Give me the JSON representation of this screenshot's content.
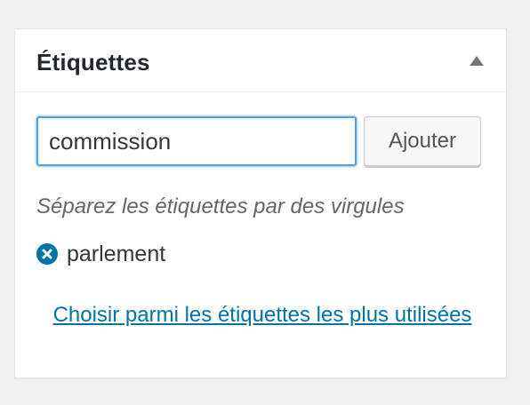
{
  "panel": {
    "title": "Étiquettes",
    "toggle_icon": "triangle-up-icon"
  },
  "tag_input": {
    "value": "commission",
    "placeholder": ""
  },
  "add_button": {
    "label": "Ajouter"
  },
  "hint": "Séparez les étiquettes par des virgules",
  "tags": [
    {
      "label": "parlement",
      "remove_icon": "remove-circle-x-icon"
    }
  ],
  "popular_link": "Choisir parmi les étiquettes les plus utilisées",
  "colors": {
    "accent": "#0073aa",
    "focus_border": "#5b9dd9",
    "text": "#32373c",
    "muted": "#666666",
    "background": "#f1f1f1"
  }
}
